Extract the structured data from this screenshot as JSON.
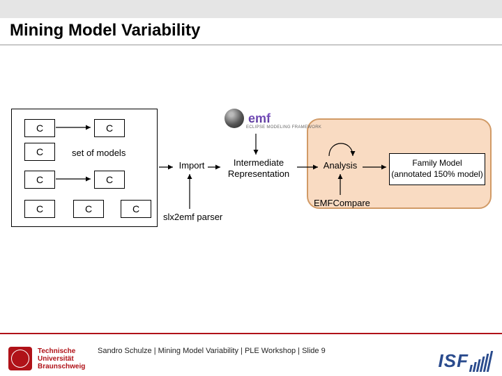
{
  "title": "Mining Model Variability",
  "diagram": {
    "models_label": "set of models",
    "component_letter": "C",
    "import_label": "Import",
    "intermediate_label_l1": "Intermediate",
    "intermediate_label_l2": "Representation",
    "analysis_label": "Analysis",
    "family_l1": "Family Model",
    "family_l2": "(annotated 150% model)",
    "parser_label": "slx2emf parser",
    "emfcompare_label": "EMFCompare",
    "emf_brand": "emf",
    "emf_sub": "ECLIPSE MODELING FRAMEWORK"
  },
  "footer": {
    "uni_l1": "Technische",
    "uni_l2": "Universität",
    "uni_l3": "Braunschweig",
    "text": "Sandro Schulze | Mining Model Variability | PLE Workshop | Slide 9",
    "isf": "ISF"
  },
  "colors": {
    "accent_red": "#b01218",
    "orange_border": "#d19a66",
    "orange_fill": "#f9dbc2",
    "isf_blue": "#2a4b8d"
  }
}
